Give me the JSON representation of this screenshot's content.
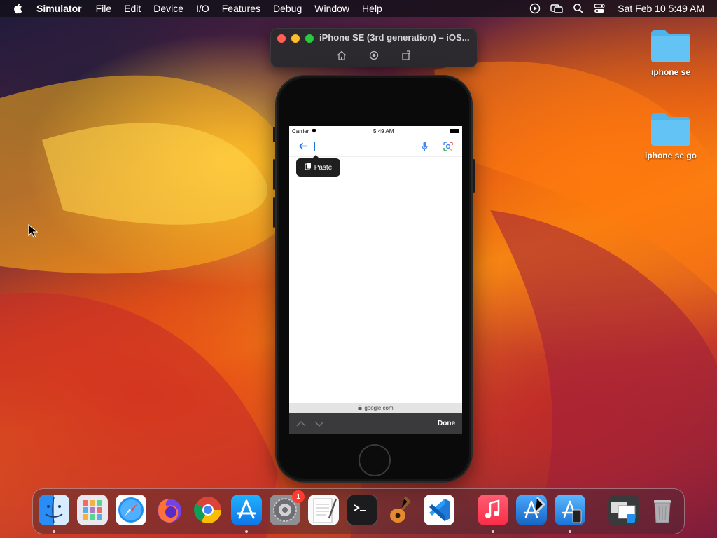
{
  "menubar": {
    "app_name": "Simulator",
    "items": [
      "File",
      "Edit",
      "Device",
      "I/O",
      "Features",
      "Debug",
      "Window",
      "Help"
    ],
    "clock": "Sat Feb 10  5:49 AM"
  },
  "desktop": {
    "icons": [
      {
        "label": "iphone se"
      },
      {
        "label": "iphone se go"
      }
    ]
  },
  "simulator": {
    "window_title": "iPhone SE (3rd generation) – iOS...",
    "traffic_colors": {
      "close": "#ff5f57",
      "minimize": "#febc2e",
      "zoom": "#28c840"
    }
  },
  "device_screen": {
    "status": {
      "carrier": "Carrier",
      "time": "5:49 AM"
    },
    "paste_label": "Paste",
    "url": "google.com",
    "keyboard_done": "Done",
    "accent_color": "#1a73e8"
  },
  "dock": {
    "apps": [
      "Finder",
      "Launchpad",
      "Safari",
      "Firefox",
      "Google Chrome",
      "App Store",
      "System Settings",
      "TextEdit",
      "Terminal",
      "GarageBand",
      "Visual Studio Code",
      "Music",
      "Xcode",
      "Simulator",
      "Downloads",
      "Trash"
    ],
    "settings_badge": "1"
  }
}
